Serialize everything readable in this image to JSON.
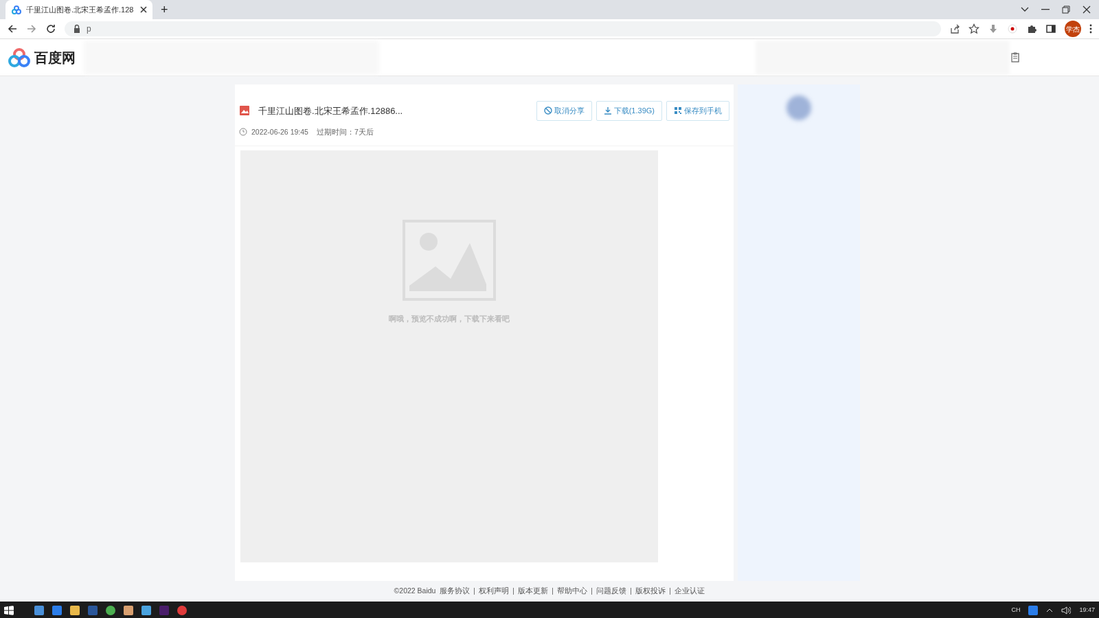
{
  "browser": {
    "tab": {
      "title": "千里江山图卷.北宋王希孟作.128",
      "selected": true
    },
    "new_tab": "+",
    "address_start": "p",
    "profile": "学杰"
  },
  "header": {
    "logo_text": "百度网"
  },
  "file": {
    "name": "千里江山图卷.北宋王希孟作.12886...",
    "date": "2022-06-26 19:45",
    "expiry": "过期时间：7天后",
    "buttons": [
      {
        "kind": "cancel",
        "label": "取消分享"
      },
      {
        "kind": "download",
        "label": "下载(1.39G)"
      },
      {
        "kind": "phone",
        "label": "保存到手机"
      }
    ]
  },
  "preview": {
    "message": "啊哦，预览不成功啊，下载下来看吧"
  },
  "footer": {
    "copyright": "©2022 Baidu",
    "links": [
      "服务协议",
      "权利声明",
      "版本更新",
      "帮助中心",
      "问题反馈",
      "版权投诉",
      "企业认证"
    ]
  },
  "taskbar": {
    "language": "CH",
    "time": "19:47"
  }
}
